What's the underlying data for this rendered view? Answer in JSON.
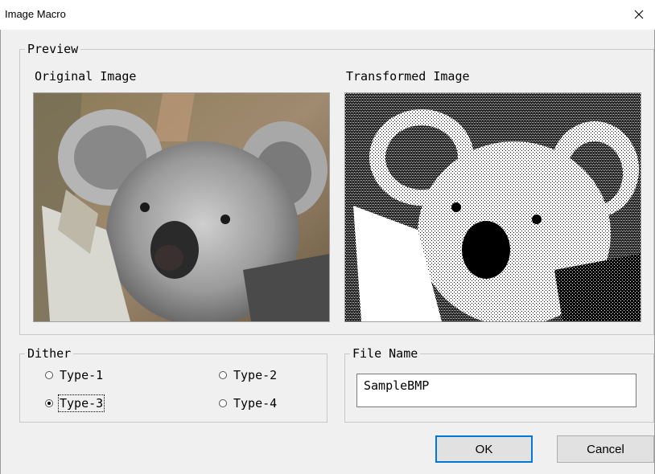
{
  "window": {
    "title": "Image Macro",
    "close_symbol": "✕"
  },
  "preview": {
    "legend": "Preview",
    "original_label": "Original Image",
    "transformed_label": "Transformed Image",
    "original_image_icon": "koala-photo-color",
    "transformed_image_icon": "koala-photo-dithered"
  },
  "dither": {
    "legend": "Dither",
    "options": [
      {
        "label": "Type-1",
        "checked": false
      },
      {
        "label": "Type-2",
        "checked": false
      },
      {
        "label": "Type-3",
        "checked": true
      },
      {
        "label": "Type-4",
        "checked": false
      }
    ]
  },
  "file": {
    "legend": "File Name",
    "value": "SampleBMP"
  },
  "buttons": {
    "ok": "OK",
    "cancel": "Cancel"
  }
}
